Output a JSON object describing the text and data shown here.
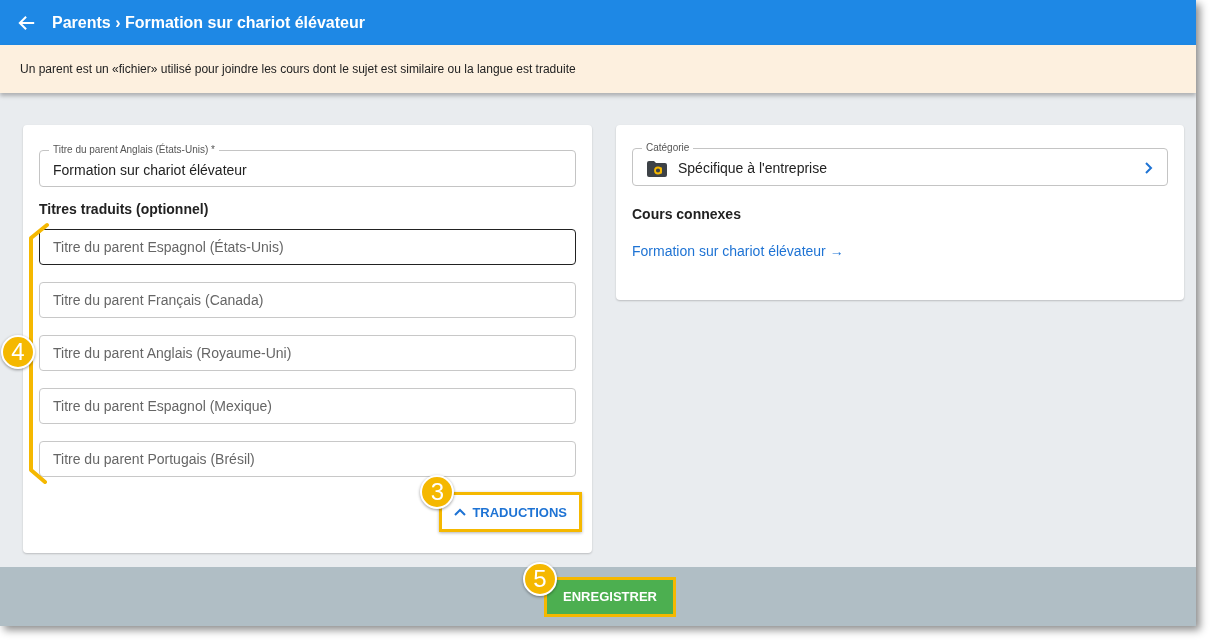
{
  "header": {
    "title": "Parents › Formation sur chariot élévateur"
  },
  "notice": "Un parent est un «fichier» utilisé pour joindre les cours dont le sujet est similaire ou la langue est traduite",
  "main_field": {
    "label": "Titre du parent Anglais (États-Unis) *",
    "value": "Formation sur chariot élévateur"
  },
  "translations": {
    "heading": "Titres traduits (optionnel)",
    "callout": "4",
    "fields": [
      {
        "placeholder": "Titre du parent Espagnol (États-Unis)",
        "focused": true
      },
      {
        "placeholder": "Titre du parent Français (Canada)",
        "focused": false
      },
      {
        "placeholder": "Titre du parent Anglais (Royaume-Uni)",
        "focused": false
      },
      {
        "placeholder": "Titre du parent Espagnol (Mexique)",
        "focused": false
      },
      {
        "placeholder": "Titre du parent Portugais (Brésil)",
        "focused": false
      }
    ],
    "toggle": {
      "label": "TRADUCTIONS",
      "expanded": true,
      "callout": "3"
    }
  },
  "category": {
    "label": "Catégorie",
    "value": "Spécifique à l'entreprise"
  },
  "related": {
    "heading": "Cours connexes",
    "links": [
      "Formation sur chariot élévateur →"
    ]
  },
  "save": {
    "label": "ENREGISTRER",
    "callout": "5"
  }
}
